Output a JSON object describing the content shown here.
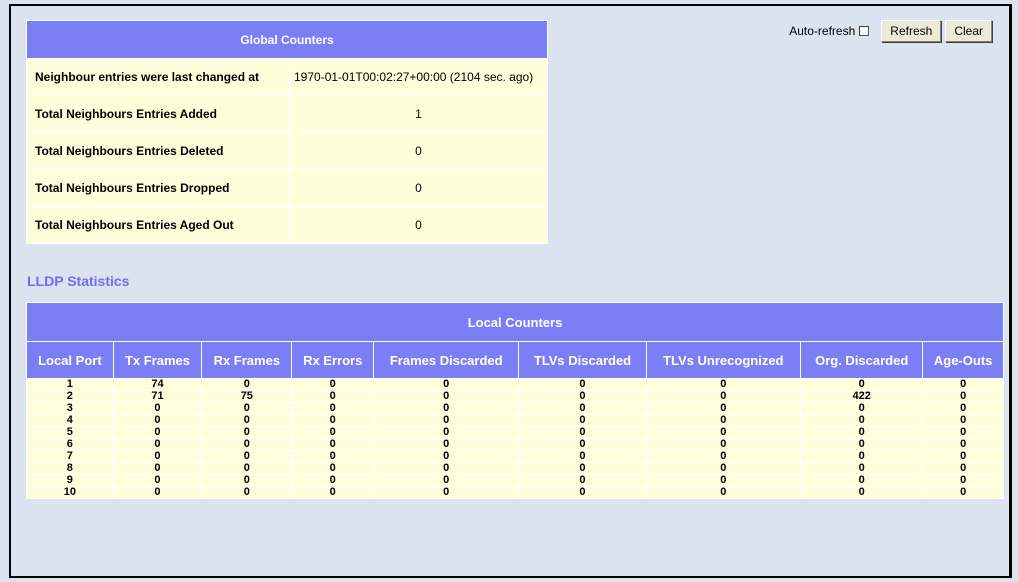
{
  "controls": {
    "auto_refresh_label": "Auto-refresh",
    "refresh_label": "Refresh",
    "clear_label": "Clear"
  },
  "global": {
    "title": "Global Counters",
    "rows": [
      {
        "label": "Neighbour entries were last changed at",
        "value": "1970-01-01T00:02:27+00:00 (2104 sec. ago)"
      },
      {
        "label": "Total Neighbours Entries Added",
        "value": "1"
      },
      {
        "label": "Total Neighbours Entries Deleted",
        "value": "0"
      },
      {
        "label": "Total Neighbours Entries Dropped",
        "value": "0"
      },
      {
        "label": "Total Neighbours Entries Aged Out",
        "value": "0"
      }
    ]
  },
  "section_title": "LLDP Statistics",
  "local": {
    "title": "Local Counters",
    "columns": [
      "Local Port",
      "Tx Frames",
      "Rx Frames",
      "Rx Errors",
      "Frames Discarded",
      "TLVs Discarded",
      "TLVs Unrecognized",
      "Org. Discarded",
      "Age-Outs"
    ],
    "rows": [
      [
        "1",
        "74",
        "0",
        "0",
        "0",
        "0",
        "0",
        "0",
        "0"
      ],
      [
        "2",
        "71",
        "75",
        "0",
        "0",
        "0",
        "0",
        "422",
        "0"
      ],
      [
        "3",
        "0",
        "0",
        "0",
        "0",
        "0",
        "0",
        "0",
        "0"
      ],
      [
        "4",
        "0",
        "0",
        "0",
        "0",
        "0",
        "0",
        "0",
        "0"
      ],
      [
        "5",
        "0",
        "0",
        "0",
        "0",
        "0",
        "0",
        "0",
        "0"
      ],
      [
        "6",
        "0",
        "0",
        "0",
        "0",
        "0",
        "0",
        "0",
        "0"
      ],
      [
        "7",
        "0",
        "0",
        "0",
        "0",
        "0",
        "0",
        "0",
        "0"
      ],
      [
        "8",
        "0",
        "0",
        "0",
        "0",
        "0",
        "0",
        "0",
        "0"
      ],
      [
        "9",
        "0",
        "0",
        "0",
        "0",
        "0",
        "0",
        "0",
        "0"
      ],
      [
        "10",
        "0",
        "0",
        "0",
        "0",
        "0",
        "0",
        "0",
        "0"
      ]
    ]
  }
}
